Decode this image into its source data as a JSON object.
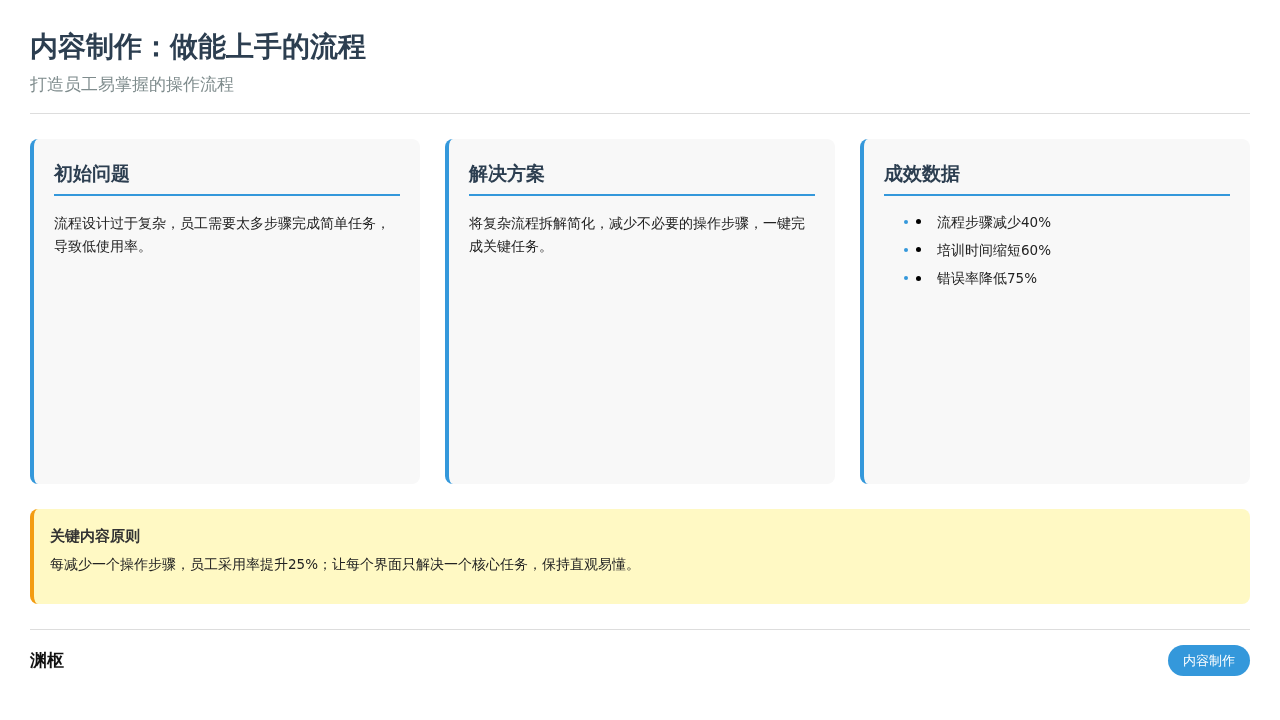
{
  "header": {
    "title": "内容制作：做能上手的流程",
    "subtitle": "打造员工易掌握的操作流程"
  },
  "cards": [
    {
      "kind": "text",
      "title": "初始问题",
      "text": "流程设计过于复杂，员工需要太多步骤完成简单任务，导致低使用率。"
    },
    {
      "kind": "text",
      "title": "解决方案",
      "text": "将复杂流程拆解简化，减少不必要的操作步骤，一键完成关键任务。"
    },
    {
      "kind": "list",
      "title": "成效数据",
      "items": [
        "流程步骤减少40%",
        "培训时间缩短60%",
        "错误率降低75%"
      ]
    }
  ],
  "callout": {
    "title": "关键内容原则",
    "text": "每减少一个操作步骤，员工采用率提升25%；让每个界面只解决一个核心任务，保持直观易懂。"
  },
  "footer": {
    "brand": "渊枢",
    "tag": "内容制作"
  }
}
